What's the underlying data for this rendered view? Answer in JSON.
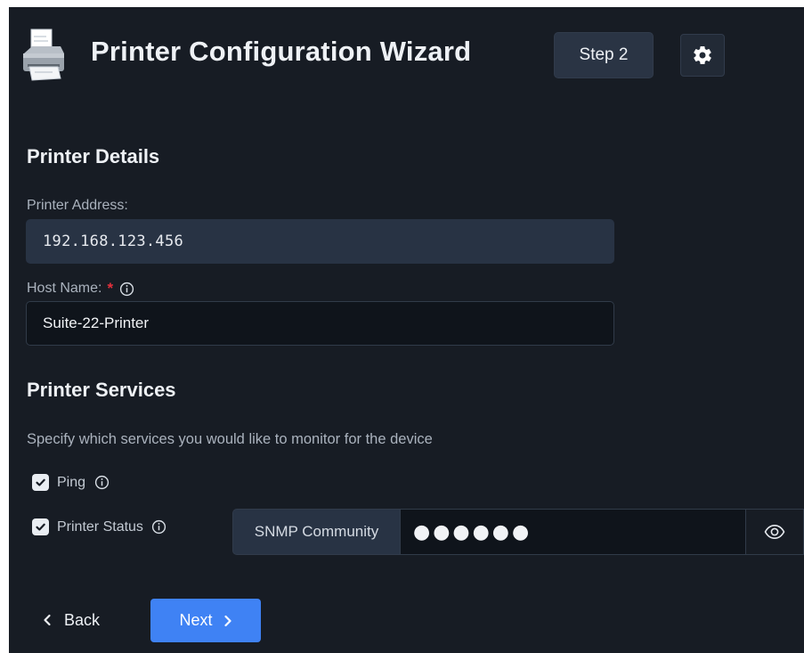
{
  "header": {
    "title": "Printer Configuration Wizard",
    "step_label": "Step 2"
  },
  "printer_details": {
    "heading": "Printer Details",
    "address_label": "Printer Address:",
    "address_value": "192.168.123.456",
    "host_label": "Host Name:",
    "host_required_mark": "*",
    "host_value": "Suite-22-Printer"
  },
  "printer_services": {
    "heading": "Printer Services",
    "description": "Specify which services you would like to monitor for the device",
    "ping": {
      "label": "Ping",
      "checked": true
    },
    "printer_status": {
      "label": "Printer Status",
      "checked": true
    },
    "snmp": {
      "label": "SNMP Community",
      "masked_value": "●●●●●●"
    }
  },
  "footer": {
    "back_label": "Back",
    "next_label": "Next"
  },
  "colors": {
    "background": "#171c24",
    "accent": "#3f82f4",
    "required": "#e5303c"
  },
  "icons": {
    "app": "printer-icon",
    "settings": "gear-icon",
    "info": "info-icon",
    "reveal": "eye-icon",
    "back": "chevron-left-icon",
    "next": "chevron-right-icon"
  }
}
